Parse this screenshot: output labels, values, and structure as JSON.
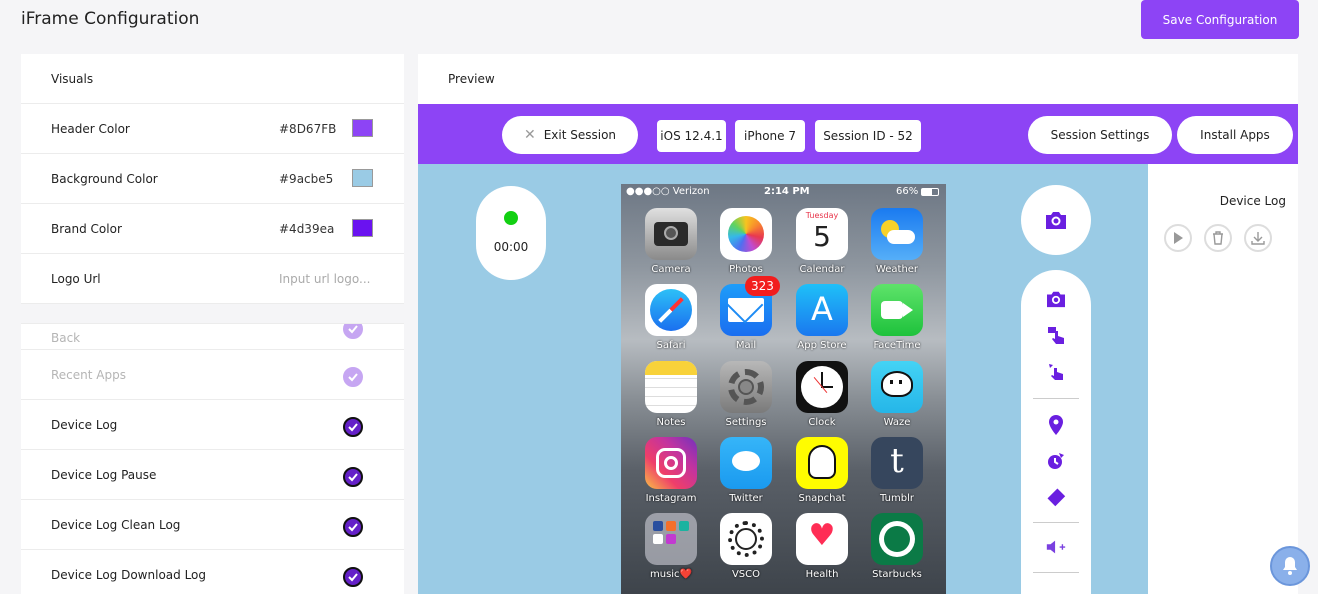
{
  "page": {
    "title": "iFrame Configuration",
    "save_label": "Save Configuration"
  },
  "visuals": {
    "section_title": "Visuals",
    "header_color": {
      "label": "Header Color",
      "value": "#8D67FB",
      "swatch": "#8D44F5"
    },
    "background_color": {
      "label": "Background Color",
      "value": "#9acbe5",
      "swatch": "#9acbe5"
    },
    "brand_color": {
      "label": "Brand Color",
      "value": "#4d39ea",
      "swatch": "#6a12f0"
    },
    "logo_url": {
      "label": "Logo Url",
      "placeholder": "Input url logo..."
    }
  },
  "options": [
    {
      "label": "Back",
      "checked": true,
      "faded": true
    },
    {
      "label": "Recent Apps",
      "checked": true,
      "faded": true
    },
    {
      "label": "Device Log",
      "checked": true,
      "faded": false
    },
    {
      "label": "Device Log Pause",
      "checked": true,
      "faded": false
    },
    {
      "label": "Device Log Clean Log",
      "checked": true,
      "faded": false
    },
    {
      "label": "Device Log Download Log",
      "checked": true,
      "faded": false
    }
  ],
  "preview": {
    "label": "Preview",
    "exit_label": "Exit Session",
    "os": "iOS 12.4.1",
    "device": "iPhone 7",
    "session_id": "Session ID - 52",
    "session_settings": "Session Settings",
    "install_apps": "Install Apps",
    "timer": "00:00",
    "device_log_title": "Device Log"
  },
  "phone": {
    "carrier": "●●●○○ Verizon",
    "time": "2:14 PM",
    "battery": "66%",
    "calendar_day": "Tuesday",
    "calendar_date": "5",
    "mail_badge": "323",
    "apps": [
      {
        "label": "Camera"
      },
      {
        "label": "Photos"
      },
      {
        "label": "Calendar"
      },
      {
        "label": "Weather"
      },
      {
        "label": "Safari"
      },
      {
        "label": "Mail"
      },
      {
        "label": "App Store"
      },
      {
        "label": "FaceTime"
      },
      {
        "label": "Notes"
      },
      {
        "label": "Settings"
      },
      {
        "label": "Clock"
      },
      {
        "label": "Waze"
      },
      {
        "label": "Instagram"
      },
      {
        "label": "Twitter"
      },
      {
        "label": "Snapchat"
      },
      {
        "label": "Tumblr"
      },
      {
        "label": "music❤️"
      },
      {
        "label": "VSCO"
      },
      {
        "label": "Health"
      },
      {
        "label": "Starbucks"
      }
    ]
  }
}
